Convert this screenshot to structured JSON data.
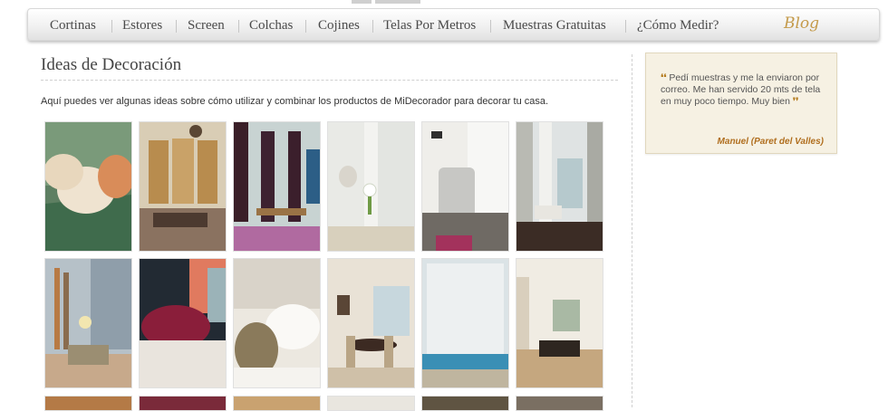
{
  "nav": {
    "items": [
      {
        "label": "Cortinas"
      },
      {
        "label": "Estores"
      },
      {
        "label": "Screen"
      },
      {
        "label": "Colchas"
      },
      {
        "label": "Cojines"
      },
      {
        "label": "Telas Por Metros"
      },
      {
        "label": "Muestras Gratuitas"
      },
      {
        "label": "¿Cómo Medir?"
      }
    ],
    "blog_label": "Blog"
  },
  "main": {
    "title": "Ideas de Decoración",
    "intro": "Aquí puedes ver algunas ideas sobre cómo utilizar y combinar los productos de MiDecorador para decorar tu casa."
  },
  "gallery": {
    "images": [
      "green sofa with cream and orange cushions",
      "living room with bay windows and chandelier",
      "room with dark curtains and desk",
      "white curtains with lamp and flowers",
      "armchair by window with white curtains",
      "room with white and grey curtains and dark floor",
      "room with grey blinds and floor lamp",
      "bed with burgundy cushions",
      "white cushions on bed with headboard",
      "dining room with round table and chairs",
      "white roller blinds over terrace",
      "living room with patterned curtains"
    ]
  },
  "testimonial": {
    "open_mark": "❛❛",
    "text": "Pedí muestras y me la enviaron por correo. Me han servido 20 mts de tela en muy poco tiempo. Muy bien",
    "close_mark": "❜❜",
    "author": "Manuel (Paret del Valles)"
  },
  "colors": {
    "nav_text": "#4a4a4a",
    "blog_accent": "#c49a4a",
    "quote_bg": "#f6f1e3",
    "author": "#b06e1e"
  }
}
